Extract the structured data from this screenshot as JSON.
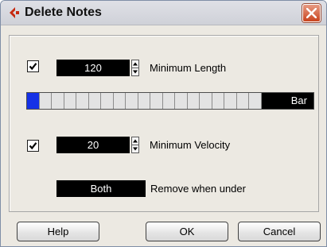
{
  "window": {
    "title": "Delete Notes"
  },
  "min_length": {
    "checked": true,
    "value": "120",
    "label": "Minimum Length"
  },
  "bar_strip": {
    "cells": 16,
    "active_index": 0,
    "label": "Bar"
  },
  "min_velocity": {
    "checked": true,
    "value": "20",
    "label": "Minimum Velocity"
  },
  "remove": {
    "value": "Both",
    "label": "Remove when under"
  },
  "buttons": {
    "help": "Help",
    "ok": "OK",
    "cancel": "Cancel"
  },
  "colors": {
    "active_cell": "#1531e6",
    "close_button": "#c9441e",
    "app_icon": "#c62a10"
  }
}
